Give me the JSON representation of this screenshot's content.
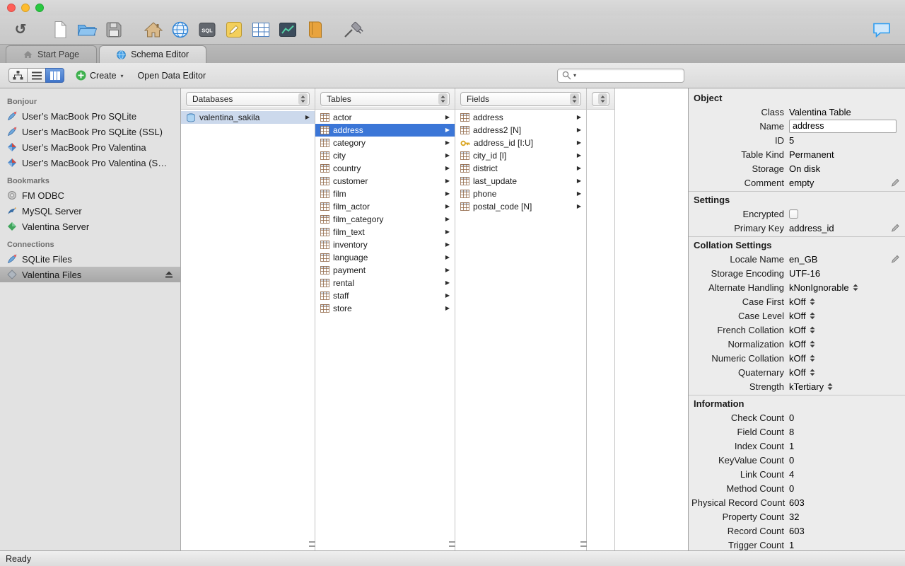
{
  "colors": {
    "selection": "#3b76d7",
    "inactive_selection": "#ccd9ec",
    "create_green": "#3eb14e",
    "chat_blue": "#2b9cf2"
  },
  "toolbar": {
    "groups": [
      [
        "undo"
      ],
      [
        "new-document",
        "open",
        "save"
      ],
      [
        "home",
        "web",
        "sql-editor",
        "schema-diagram",
        "table",
        "report",
        "book"
      ],
      [
        "connection"
      ]
    ],
    "right_icons": [
      "chat"
    ]
  },
  "tabs": [
    {
      "label": "Start Page",
      "icon": "tab-home"
    },
    {
      "label": "Schema Editor",
      "icon": "tab-schema",
      "active": true
    }
  ],
  "subtoolbar": {
    "view_modes": [
      {
        "name": "tree"
      },
      {
        "name": "list"
      },
      {
        "name": "columns",
        "active": true
      }
    ],
    "create_label": "Create",
    "open_data_editor_label": "Open Data Editor",
    "search_value": "",
    "search_placeholder": ""
  },
  "sidebar": {
    "sections": [
      {
        "title": "Bonjour",
        "items": [
          {
            "label": "User’s MacBook Pro SQLite",
            "icon": "sqlite"
          },
          {
            "label": "User’s MacBook Pro SQLite (SSL)",
            "icon": "sqlite"
          },
          {
            "label": "User’s MacBook Pro Valentina",
            "icon": "valentina"
          },
          {
            "label": "User’s MacBook Pro Valentina (S…",
            "icon": "valentina"
          }
        ]
      },
      {
        "title": "Bookmarks",
        "items": [
          {
            "label": "FM ODBC",
            "icon": "odbc"
          },
          {
            "label": "MySQL Server",
            "icon": "mysql"
          },
          {
            "label": "Valentina Server",
            "icon": "valentina-server"
          }
        ]
      },
      {
        "title": "Connections",
        "items": [
          {
            "label": "SQLite Files",
            "icon": "sqlite-files"
          },
          {
            "label": "Valentina Files",
            "icon": "valentina-files",
            "selected": true,
            "eject": true
          }
        ]
      }
    ]
  },
  "browser": {
    "columns": [
      {
        "header": "Databases",
        "item_icon": "database",
        "arrows": true,
        "items": [
          {
            "label": "valentina_sakila",
            "selected": "inactive"
          }
        ]
      },
      {
        "header": "Tables",
        "item_icon": "table",
        "arrows": true,
        "items": [
          "actor",
          {
            "label": "address",
            "selected": "active"
          },
          "category",
          "city",
          "country",
          "customer",
          "film",
          "film_actor",
          "film_category",
          "film_text",
          "inventory",
          "language",
          "payment",
          "rental",
          "staff",
          "store"
        ]
      },
      {
        "header": "Fields",
        "item_icon": "field",
        "arrows": true,
        "items": [
          "address",
          "address2 [N]",
          {
            "label": "address_id [I:U]",
            "icon": "key"
          },
          "city_id [I]",
          "district",
          "last_update",
          "phone",
          "postal_code [N]"
        ]
      },
      {
        "header": "",
        "item_icon": "",
        "arrows": false,
        "items": []
      }
    ]
  },
  "inspector": {
    "sections": [
      {
        "title": "Object",
        "rows": [
          {
            "label": "Class",
            "value": "Valentina Table"
          },
          {
            "label": "Name",
            "value": "address",
            "control": "input"
          },
          {
            "label": "ID",
            "value": "5"
          },
          {
            "label": "Table Kind",
            "value": "Permanent"
          },
          {
            "label": "Storage",
            "value": "On disk"
          },
          {
            "label": "Comment",
            "value": "empty",
            "edit": true
          }
        ]
      },
      {
        "title": "Settings",
        "rows": [
          {
            "label": "Encrypted",
            "value": "",
            "control": "checkbox"
          },
          {
            "label": "Primary Key",
            "value": "address_id",
            "edit": true
          }
        ]
      },
      {
        "title": "Collation Settings",
        "rows": [
          {
            "label": "Locale Name",
            "value": "en_GB",
            "edit": true
          },
          {
            "label": "Storage Encoding",
            "value": "UTF-16"
          },
          {
            "label": "Alternate Handling",
            "value": "kNonIgnorable",
            "control": "stepper"
          },
          {
            "label": "Case First",
            "value": "kOff",
            "control": "stepper"
          },
          {
            "label": "Case Level",
            "value": "kOff",
            "control": "stepper"
          },
          {
            "label": "French Collation",
            "value": "kOff",
            "control": "stepper"
          },
          {
            "label": "Normalization",
            "value": "kOff",
            "control": "stepper"
          },
          {
            "label": "Numeric Collation",
            "value": "kOff",
            "control": "stepper"
          },
          {
            "label": "Quaternary",
            "value": "kOff",
            "control": "stepper"
          },
          {
            "label": "Strength",
            "value": "kTertiary",
            "control": "stepper"
          }
        ]
      },
      {
        "title": "Information",
        "rows": [
          {
            "label": "Check Count",
            "value": "0"
          },
          {
            "label": "Field Count",
            "value": "8"
          },
          {
            "label": "Index Count",
            "value": "1"
          },
          {
            "label": "KeyValue Count",
            "value": "0"
          },
          {
            "label": "Link Count",
            "value": "4"
          },
          {
            "label": "Method Count",
            "value": "0"
          },
          {
            "label": "Physical Record Count",
            "value": "603"
          },
          {
            "label": "Property Count",
            "value": "32"
          },
          {
            "label": "Record Count",
            "value": "603"
          },
          {
            "label": "Trigger Count",
            "value": "1"
          }
        ]
      }
    ]
  },
  "statusbar": {
    "text": "Ready"
  }
}
